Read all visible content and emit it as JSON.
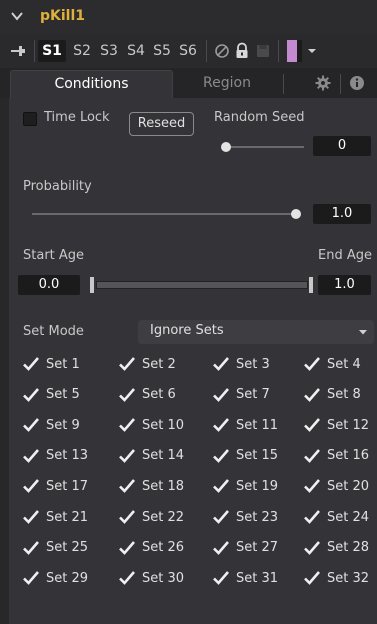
{
  "header": {
    "title": "pKill1"
  },
  "toolbar": {
    "scripts": [
      "S1",
      "S2",
      "S3",
      "S4",
      "S5",
      "S6"
    ],
    "active_script": "S1"
  },
  "tabs": [
    {
      "label": "Conditions"
    },
    {
      "label": "Region"
    }
  ],
  "conditions": {
    "time_lock_label": "Time Lock",
    "time_lock_checked": false,
    "reseed_label": "Reseed",
    "random_seed_label": "Random Seed",
    "random_seed_value": "0",
    "random_seed_level": 0.0,
    "probability_label": "Probability",
    "probability_value": "1.0",
    "probability_level": 1.0,
    "start_age_label": "Start Age",
    "start_age_value": "0.0",
    "end_age_label": "End Age",
    "end_age_value": "1.0",
    "set_mode_label": "Set Mode",
    "set_mode_value": "Ignore Sets"
  },
  "sets": [
    "Set 1",
    "Set 2",
    "Set 3",
    "Set 4",
    "Set 5",
    "Set 6",
    "Set 7",
    "Set 8",
    "Set 9",
    "Set 10",
    "Set 11",
    "Set 12",
    "Set 13",
    "Set 14",
    "Set 15",
    "Set 16",
    "Set 17",
    "Set 18",
    "Set 19",
    "Set 20",
    "Set 21",
    "Set 22",
    "Set 23",
    "Set 24",
    "Set 25",
    "Set 26",
    "Set 27",
    "Set 28",
    "Set 29",
    "Set 30",
    "Set 31",
    "Set 32"
  ],
  "colors": {
    "title": "#e0b03c",
    "swatch": "#c48ad0",
    "panel": "#343438",
    "background": "#28282a"
  },
  "icons": [
    "chevron-down-icon",
    "pin-icon",
    "disable-icon",
    "lock-icon",
    "save-icon",
    "color-swatch-icon",
    "gear-icon",
    "info-icon"
  ]
}
